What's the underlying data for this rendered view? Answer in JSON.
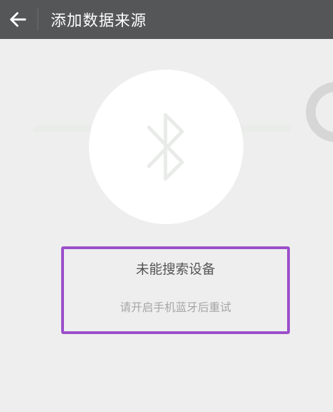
{
  "header": {
    "title": "添加数据来源",
    "back_icon": "arrow-left-icon"
  },
  "main": {
    "center_icon": "bluetooth-icon",
    "status": {
      "title": "未能搜索设备",
      "subtitle": "请开启手机蓝牙后重试"
    }
  },
  "colors": {
    "header_bg": "#555658",
    "page_bg": "#eeeeee",
    "highlight_border": "#9b4fcb"
  }
}
